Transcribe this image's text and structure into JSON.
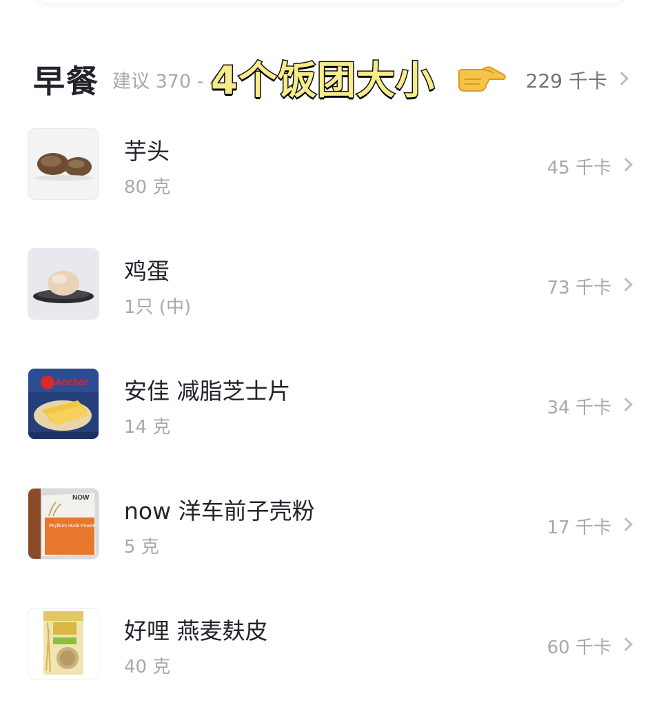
{
  "meal": {
    "title": "早餐",
    "suggestion": "建议 370 - 4",
    "total_kcal": "229 千卡",
    "overlay_caption": "4个饭团大小"
  },
  "foods": [
    {
      "name": "芋头",
      "amount": "80 克",
      "kcal": "45 千卡",
      "icon": "taro-photo"
    },
    {
      "name": "鸡蛋",
      "amount": "1只 (中)",
      "kcal": "73 千卡",
      "icon": "egg-photo"
    },
    {
      "name": "安佳 减脂芝士片",
      "amount": "14 克",
      "kcal": "34 千卡",
      "icon": "anchor-cheese-photo",
      "brand": "Anchor"
    },
    {
      "name": "now 洋车前子壳粉",
      "amount": "5 克",
      "kcal": "17 千卡",
      "icon": "psyllium-powder-photo",
      "brand": "NOW",
      "package_text": "Psyllium Husk Powder"
    },
    {
      "name": "好哩 燕麦麸皮",
      "amount": "40 克",
      "kcal": "60 千卡",
      "icon": "oat-bran-photo"
    }
  ]
}
